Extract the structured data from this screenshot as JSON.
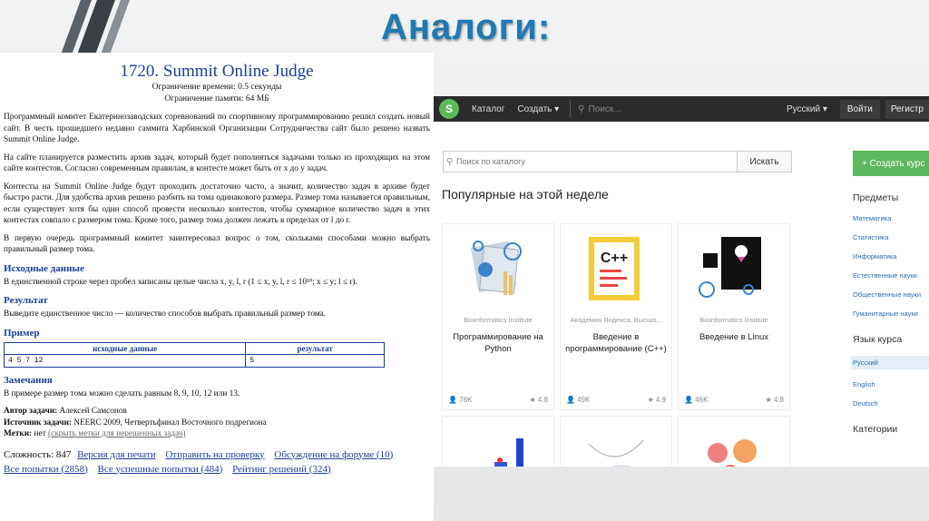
{
  "slide": {
    "title": "Аналоги:"
  },
  "timus": {
    "title": "1720. Summit Online Judge",
    "time_limit": "Ограничение времени: 0.5 секунды",
    "memory_limit": "Ограничение памяти: 64 МБ",
    "para1": "Программный комитет Екатеринозаводских соревнований по спортивному программированию решил создать новый сайт. В честь прошедшего недавно саммита Харбинской Организации Сотрудничества сайт было решено назвать Summit Online Judge.",
    "para2": "На сайте планируется разместить архив задач, который будет пополняться задачами только из проходящих на этом сайте контестов. Согласно современным правилам, в контесте может быть от x до y задач.",
    "para3": "Контесты на Summit Online Judge будут проходить достаточно часто, а значит, количество задач в архиве будет быстро расти. Для удобства архив решено разбить на тома одинакового размера. Размер тома называется правильным, если существует хотя бы один способ провести несколько контестов, чтобы суммарное количество задач в этих контестах совпало с размером тома. Кроме того, размер тома должен лежать в пределах от l до r.",
    "para4": "В первую очередь программный комитет заинтересовал вопрос о том, скольками способами можно выбрать правильный размер тома.",
    "input_heading": "Исходные данные",
    "input_text": "В единственной строке через пробел записаны целые числа x, y, l, r (1 ≤ x, y, l, r ≤ 10¹⁸; x ≤ y; l ≤ r).",
    "output_heading": "Результат",
    "output_text": "Выведите единственное число — количество способов выбрать правильный размер тома.",
    "example_heading": "Пример",
    "table_headers": [
      "исходные данные",
      "результат"
    ],
    "table_row": [
      "4 5 7 12",
      "5"
    ],
    "notes_heading": "Замечания",
    "notes_text": "В примере размер тома можно сделать равным 8, 9, 10, 12 или 13.",
    "author_label": "Автор задачи:",
    "author": "Алексей Самсонов",
    "source_label": "Источник задачи:",
    "source": "NEERC 2009, Четвертьфинал Восточного подрегиона",
    "tags_label": "Метки:",
    "tags_value": "нет",
    "tags_link": "(скрыть метки для нерешенных задач)",
    "difficulty": "Сложность: 847",
    "link_print": "Версия для печати",
    "link_submit": "Отправить на проверку",
    "link_forum": "Обсуждение на форуме (10)",
    "link_all": "Все попытки (2858)",
    "link_success": "Все успешные попытки (484)",
    "link_rating": "Рейтинг решений (324)"
  },
  "stepik": {
    "nav_catalog": "Каталог",
    "nav_create": "Создать ▾",
    "nav_search": "Поиск...",
    "lang": "Русский ▾",
    "login": "Войти",
    "register": "Регистр",
    "search_placeholder": "Поиск по каталогу",
    "search_button": "Искать",
    "popular_title": "Популярные на этой неделе",
    "cards": [
      {
        "org": "Bioinformatics Institute",
        "name": "Программирование на Python",
        "learners": "76K",
        "rating": "4.8"
      },
      {
        "org": "Академия Яндекса, Высша...",
        "name": "Введение в программирование (C++)",
        "learners": "49K",
        "rating": "4.9"
      },
      {
        "org": "Bioinformatics Institute",
        "name": "Введение в Linux",
        "learners": "46K",
        "rating": "4.8"
      }
    ],
    "create_course": "+ Создать курс",
    "subjects_heading": "Предметы",
    "subjects": [
      "Математика",
      "Статистика",
      "Информатика",
      "Естественные науки",
      "Общественные науки",
      "Гуманитарные науки"
    ],
    "language_heading": "Язык курса",
    "languages": [
      "Русский",
      "English",
      "Deutsch"
    ],
    "categories_heading": "Категории"
  }
}
